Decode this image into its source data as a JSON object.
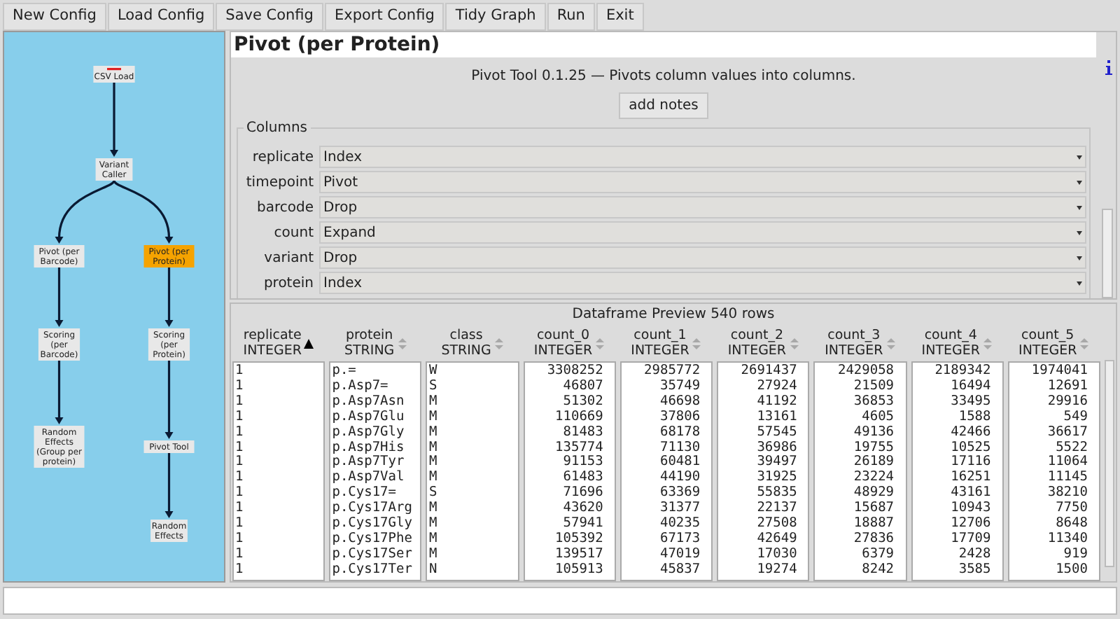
{
  "toolbar": [
    "New Config",
    "Load Config",
    "Save Config",
    "Export Config",
    "Tidy Graph",
    "Run",
    "Exit"
  ],
  "graph": {
    "nodes": [
      {
        "label": "CSV Load",
        "selected": false,
        "marked": true,
        "children": [
          {
            "label": "Variant Caller",
            "selected": false,
            "marked": false,
            "children": [
              {
                "label": "Pivot (per Barcode)",
                "selected": false,
                "marked": false,
                "children": [
                  {
                    "label": "Scoring (per Barcode)",
                    "selected": false,
                    "marked": false,
                    "children": [
                      {
                        "label": "Random Effects (Group per protein)",
                        "selected": false,
                        "marked": false
                      }
                    ]
                  }
                ]
              },
              {
                "label": "Pivot (per Protein)",
                "selected": true,
                "marked": false,
                "children": [
                  {
                    "label": "Scoring (per Protein)",
                    "selected": false,
                    "marked": false,
                    "children": [
                      {
                        "label": "Pivot Tool",
                        "selected": false,
                        "marked": false,
                        "children": [
                          {
                            "label": "Random Effects",
                            "selected": false,
                            "marked": false
                          }
                        ]
                      }
                    ]
                  }
                ]
              }
            ]
          }
        ]
      }
    ]
  },
  "node_title": "Pivot (per Protein)",
  "description": "Pivot Tool 0.1.25 — Pivots column values into columns.",
  "notes_button": "add notes",
  "columns_group": {
    "title": "Columns",
    "rows": [
      {
        "label": "replicate",
        "value": "Index"
      },
      {
        "label": "timepoint",
        "value": "Pivot"
      },
      {
        "label": "barcode",
        "value": "Drop"
      },
      {
        "label": "count",
        "value": "Expand"
      },
      {
        "label": "variant",
        "value": "Drop"
      },
      {
        "label": "protein",
        "value": "Index"
      }
    ]
  },
  "preview": {
    "title": "Dataframe Preview 540 rows",
    "columns": [
      {
        "name": "replicate",
        "type": "INTEGER",
        "sorted": true,
        "kind": "text"
      },
      {
        "name": "protein",
        "type": "STRING",
        "sorted": false,
        "kind": "text"
      },
      {
        "name": "class",
        "type": "STRING",
        "sorted": false,
        "kind": "text"
      },
      {
        "name": "count_0",
        "type": "INTEGER",
        "sorted": false,
        "kind": "number"
      },
      {
        "name": "count_1",
        "type": "INTEGER",
        "sorted": false,
        "kind": "number"
      },
      {
        "name": "count_2",
        "type": "INTEGER",
        "sorted": false,
        "kind": "number"
      },
      {
        "name": "count_3",
        "type": "INTEGER",
        "sorted": false,
        "kind": "number"
      },
      {
        "name": "count_4",
        "type": "INTEGER",
        "sorted": false,
        "kind": "number"
      },
      {
        "name": "count_5",
        "type": "INTEGER",
        "sorted": false,
        "kind": "number"
      }
    ],
    "rows": [
      [
        "1",
        "p.=",
        "W",
        "3308252",
        "2985772",
        "2691437",
        "2429058",
        "2189342",
        "1974041"
      ],
      [
        "1",
        "p.Asp7=",
        "S",
        "46807",
        "35749",
        "27924",
        "21509",
        "16494",
        "12691"
      ],
      [
        "1",
        "p.Asp7Asn",
        "M",
        "51302",
        "46698",
        "41192",
        "36853",
        "33495",
        "29916"
      ],
      [
        "1",
        "p.Asp7Glu",
        "M",
        "110669",
        "37806",
        "13161",
        "4605",
        "1588",
        "549"
      ],
      [
        "1",
        "p.Asp7Gly",
        "M",
        "81483",
        "68178",
        "57545",
        "49136",
        "42466",
        "36617"
      ],
      [
        "1",
        "p.Asp7His",
        "M",
        "135774",
        "71130",
        "36986",
        "19755",
        "10525",
        "5522"
      ],
      [
        "1",
        "p.Asp7Tyr",
        "M",
        "91153",
        "60481",
        "39497",
        "26189",
        "17116",
        "11064"
      ],
      [
        "1",
        "p.Asp7Val",
        "M",
        "61483",
        "44190",
        "31925",
        "23224",
        "16251",
        "11145"
      ],
      [
        "1",
        "p.Cys17=",
        "S",
        "71696",
        "63369",
        "55835",
        "48929",
        "43161",
        "38210"
      ],
      [
        "1",
        "p.Cys17Arg",
        "M",
        "43620",
        "31377",
        "22137",
        "15687",
        "10943",
        "7750"
      ],
      [
        "1",
        "p.Cys17Gly",
        "M",
        "57941",
        "40235",
        "27508",
        "18887",
        "12706",
        "8648"
      ],
      [
        "1",
        "p.Cys17Phe",
        "M",
        "105392",
        "67173",
        "42649",
        "27836",
        "17709",
        "11340"
      ],
      [
        "1",
        "p.Cys17Ser",
        "M",
        "139517",
        "47019",
        "17030",
        "6379",
        "2428",
        "919"
      ],
      [
        "1",
        "p.Cys17Ter",
        "N",
        "105913",
        "45837",
        "19274",
        "8242",
        "3585",
        "1500"
      ]
    ]
  }
}
